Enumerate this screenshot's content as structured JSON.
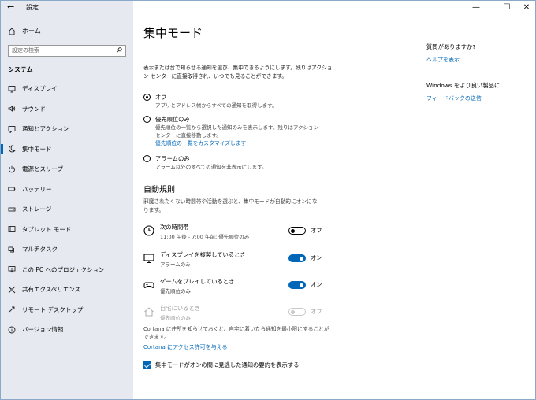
{
  "window": {
    "title": "設定",
    "back_icon": "back-arrow-icon",
    "controls": {
      "minimize": "—",
      "maximize": "☐",
      "close": "✕"
    }
  },
  "sidebar": {
    "home_label": "ホーム",
    "search_placeholder": "設定の検索",
    "section_label": "システム",
    "items": [
      {
        "label": "ディスプレイ",
        "icon": "display-icon"
      },
      {
        "label": "サウンド",
        "icon": "sound-icon"
      },
      {
        "label": "通知とアクション",
        "icon": "notifications-icon"
      },
      {
        "label": "集中モード",
        "icon": "moon-icon",
        "active": true
      },
      {
        "label": "電源とスリープ",
        "icon": "power-icon"
      },
      {
        "label": "バッテリー",
        "icon": "battery-icon"
      },
      {
        "label": "ストレージ",
        "icon": "storage-icon"
      },
      {
        "label": "タブレット モード",
        "icon": "tablet-icon"
      },
      {
        "label": "マルチタスク",
        "icon": "multitask-icon"
      },
      {
        "label": "この PC へのプロジェクション",
        "icon": "projection-icon"
      },
      {
        "label": "共有エクスペリエンス",
        "icon": "shared-icon"
      },
      {
        "label": "リモート デスクトップ",
        "icon": "remote-icon"
      },
      {
        "label": "バージョン情報",
        "icon": "info-icon"
      }
    ]
  },
  "main": {
    "title": "集中モード",
    "description": "表示または音で知らせる通知を選び、集中できるようにします。残りはアクション センターに直接取得され、いつでも見ることができます。",
    "options": [
      {
        "label": "オフ",
        "sub": "アプリとアドレス帳からすべての通知を取得します。",
        "checked": true
      },
      {
        "label": "優先順位のみ",
        "sub": "優先順位の一覧から選択した通知のみを表示します。残りはアクション センターに直接移動します。",
        "link": "優先順位の一覧をカスタマイズします",
        "checked": false
      },
      {
        "label": "アラームのみ",
        "sub": "アラーム以外のすべての通知を非表示にします。",
        "checked": false
      }
    ],
    "rules_heading": "自動規則",
    "rules_description": "邪魔されたくない時間帯や活動を選ぶと、集中モードが自動的にオンになります。",
    "rules": [
      {
        "title": "次の時間帯",
        "sub": "11:00 午後 - 7:00 午前; 優先順位のみ",
        "state": "off",
        "state_label": "オフ",
        "icon": "clock-icon"
      },
      {
        "title": "ディスプレイを複製しているとき",
        "sub": "アラームのみ",
        "state": "on",
        "state_label": "オン",
        "icon": "monitor-icon"
      },
      {
        "title": "ゲームをプレイしているとき",
        "sub": "優先順位のみ",
        "state": "on",
        "state_label": "オン",
        "icon": "gamepad-icon"
      },
      {
        "title": "自宅にいるとき",
        "sub": "優先順位のみ",
        "state": "disabled",
        "state_label": "オフ",
        "icon": "house-icon"
      }
    ],
    "cortana_text": "Cortana に住所を知らせておくと、自宅に着いたら通知を最小限にすることができます。",
    "cortana_link": "Cortana にアクセス許可を与える",
    "checkbox_label": "集中モードがオンの間に見逃した通知の要約を表示する",
    "checkbox_checked": true
  },
  "aside": {
    "question": "質問がありますか?",
    "help_link": "ヘルプを表示",
    "improve": "Windows をより良い製品に",
    "feedback_link": "フィードバックの送信"
  },
  "colors": {
    "accent": "#0067b8",
    "sidebar_bg": "#e6eaf0"
  }
}
